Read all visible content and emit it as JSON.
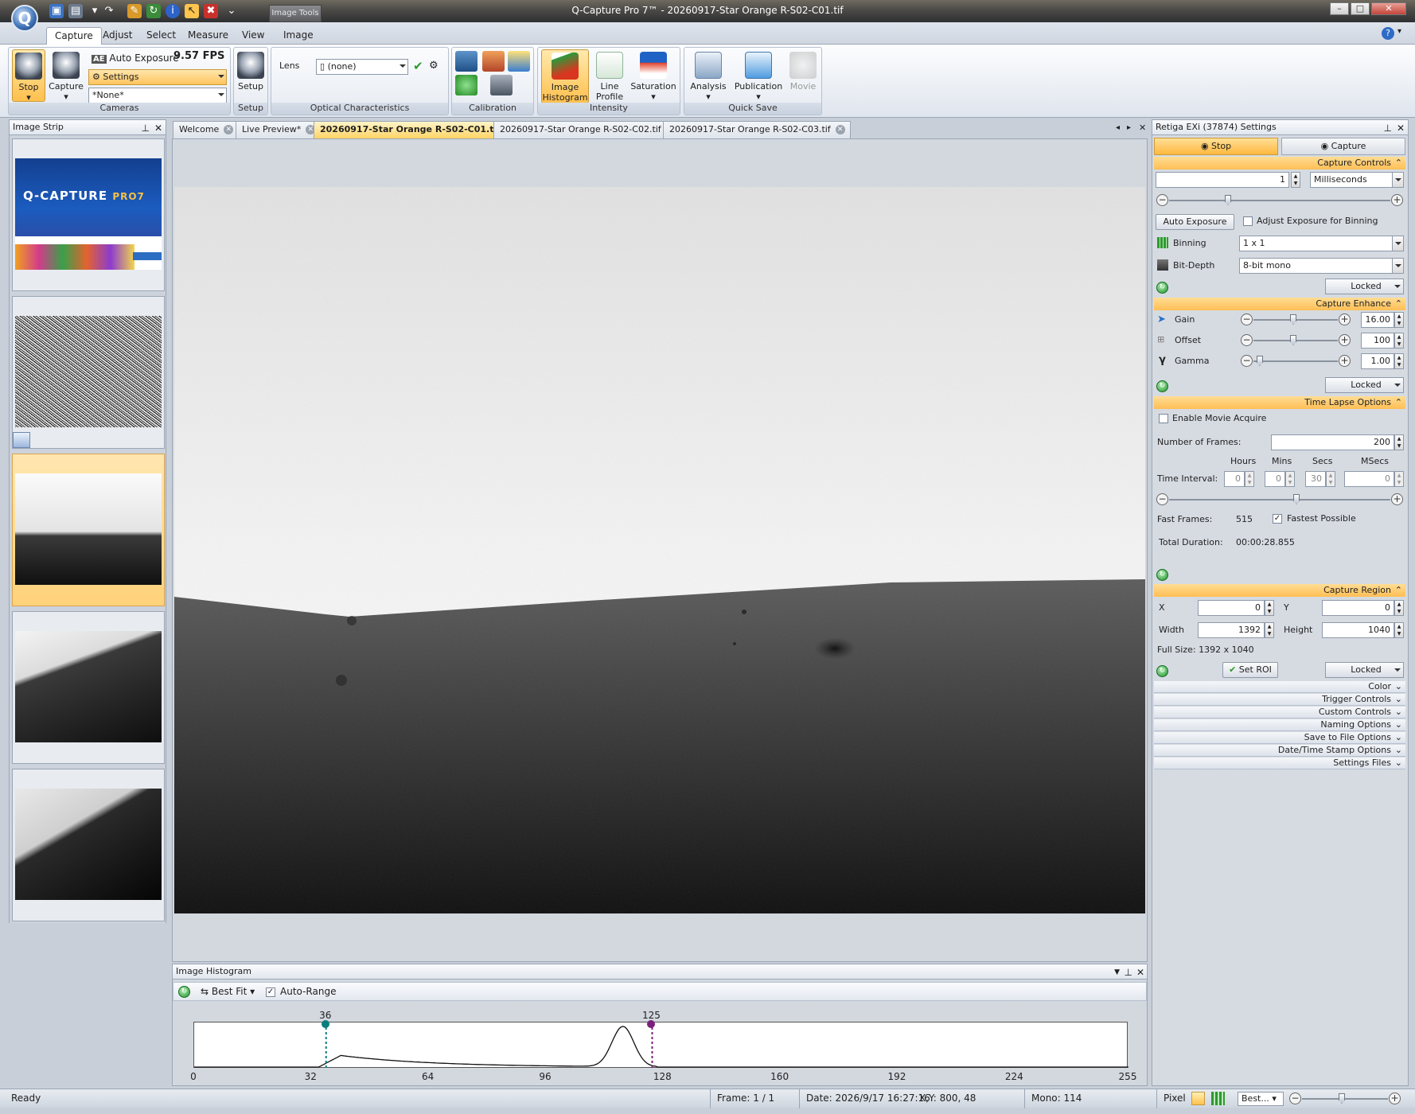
{
  "window": {
    "title": "Q-Capture Pro 7™ - 20260917-Star Orange R-S02-C01.tif",
    "image_tools_tab": "Image Tools"
  },
  "menu": {
    "tabs": [
      "Capture",
      "Adjust",
      "Select",
      "Measure",
      "View",
      "Image"
    ],
    "active": "Capture"
  },
  "ribbon": {
    "cameras": {
      "stop": "Stop",
      "capture": "Capture",
      "auto_exposure": "Auto Exposure",
      "fps": "9.57 FPS",
      "settings": "Settings",
      "preset": "*None*",
      "label": "Cameras"
    },
    "setup": {
      "button": "Setup",
      "label": "Setup"
    },
    "optical": {
      "lens_label": "Lens",
      "lens_value": "(none)",
      "label": "Optical Characteristics"
    },
    "calibration": {
      "label": "Calibration"
    },
    "intensity": {
      "image_histogram_1": "Image",
      "image_histogram_2": "Histogram",
      "line_profile_1": "Line",
      "line_profile_2": "Profile",
      "saturation": "Saturation",
      "label": "Intensity"
    },
    "quick_save": {
      "analysis": "Analysis",
      "publication": "Publication",
      "movie": "Movie",
      "label": "Quick Save"
    }
  },
  "image_strip": {
    "title": "Image Strip"
  },
  "splash": {
    "brand": "Q-CAPTURE",
    "brand_suffix": "PRO7"
  },
  "doc_tabs": [
    "Welcome",
    "Live Preview*",
    "20260917-Star Orange R-S02-C01.tif",
    "20260917-Star Orange R-S02-C02.tif",
    "20260917-Star Orange R-S02-C03.tif"
  ],
  "histogram": {
    "title": "Image Histogram",
    "fit": "Best Fit",
    "auto_range": "Auto-Range",
    "low_marker": 36,
    "high_marker": 125,
    "ticks": [
      "0",
      "32",
      "64",
      "96",
      "128",
      "160",
      "192",
      "224",
      "255"
    ]
  },
  "status": {
    "ready": "Ready",
    "frame": "Frame: 1 / 1",
    "date": "Date: 2026/9/17 16:27:16",
    "xy": "X,Y:  800,   48",
    "mono": "Mono:  114",
    "pixel": "Pixel",
    "zoom": "Best..."
  },
  "settings": {
    "title": "Retiga EXi (37874) Settings",
    "stop": "Stop",
    "capture": "Capture",
    "capture_controls": {
      "header": "Capture Controls",
      "exposure_value": "1",
      "exposure_unit": "Milliseconds",
      "auto_exposure": "Auto Exposure",
      "adjust_binning": "Adjust Exposure for Binning",
      "binning_label": "Binning",
      "binning_value": "1 x 1",
      "bitdepth_label": "Bit-Depth",
      "bitdepth_value": "8-bit mono",
      "locked": "Locked"
    },
    "capture_enhance": {
      "header": "Capture Enhance",
      "gain_label": "Gain",
      "gain_value": "16.00",
      "offset_label": "Offset",
      "offset_value": "100",
      "gamma_label": "Gamma",
      "gamma_value": "1.00",
      "locked": "Locked"
    },
    "time_lapse": {
      "header": "Time Lapse Options",
      "enable_movie": "Enable Movie Acquire",
      "frames_label": "Number of  Frames:",
      "frames_value": "200",
      "hours": "Hours",
      "mins": "Mins",
      "secs": "Secs",
      "msecs": "MSecs",
      "interval_label": "Time Interval:",
      "hours_value": "0",
      "mins_value": "0",
      "secs_value": "30",
      "msecs_value": "0",
      "fast_frames_label": "Fast Frames:",
      "fast_frames_value": "515",
      "fastest_possible": "Fastest Possible",
      "total_duration_label": "Total Duration:",
      "total_duration_value": "00:00:28.855"
    },
    "capture_region": {
      "header": "Capture Region",
      "x_label": "X",
      "x_value": "0",
      "y_label": "Y",
      "y_value": "0",
      "width_label": "Width",
      "width_value": "1392",
      "height_label": "Height",
      "height_value": "1040",
      "full_size": "Full Size: 1392 x 1040",
      "set_roi": "Set ROI",
      "locked": "Locked"
    },
    "collapsed": [
      "Color",
      "Trigger Controls",
      "Custom Controls",
      "Naming Options",
      "Save to File Options",
      "Date/Time Stamp Options",
      "Settings Files"
    ]
  },
  "colors": {
    "accent": "#ffbe55",
    "active_tab": "#ffd466",
    "panel": "#d6dbe2"
  }
}
